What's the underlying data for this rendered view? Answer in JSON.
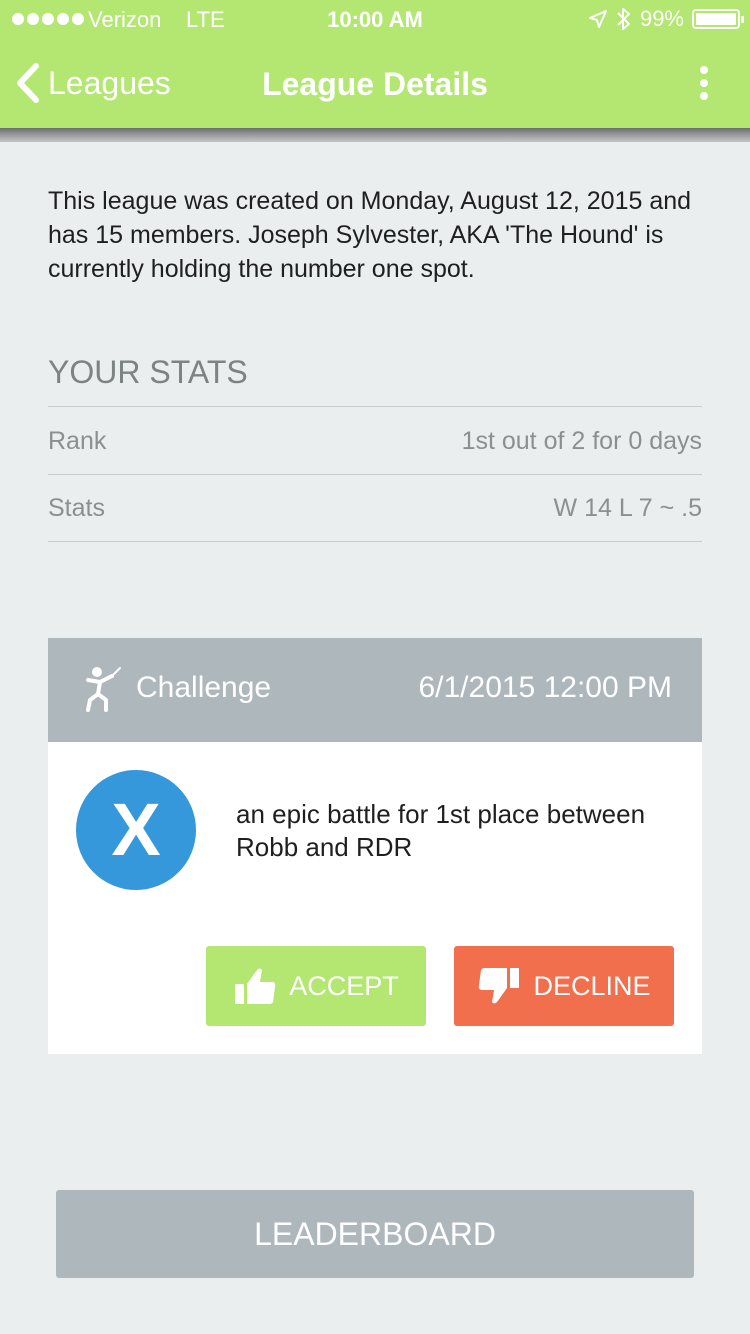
{
  "status_bar": {
    "carrier": "Verizon",
    "network": "LTE",
    "time": "10:00 AM",
    "battery": "99%"
  },
  "nav": {
    "back_label": "Leagues",
    "title": "League Details"
  },
  "intro": "This league was created on Monday, August 12, 2015 and has 15 members. Joseph Sylvester, AKA 'The Hound' is currently holding the number one spot.",
  "your_stats": {
    "title": "YOUR STATS",
    "rows": [
      {
        "label": "Rank",
        "value": "1st out of 2 for 0 days"
      },
      {
        "label": "Stats",
        "value": "W 14 L 7 ~ .5"
      }
    ]
  },
  "challenge": {
    "label": "Challenge",
    "date": "6/1/2015 12:00 PM",
    "avatar_letter": "X",
    "description": "an epic battle for 1st place between Robb and RDR",
    "accept_label": "ACCEPT",
    "decline_label": "DECLINE"
  },
  "leaderboard_label": "LEADERBOARD",
  "colors": {
    "accent_green": "#b3e772",
    "decline_red": "#f26f4e",
    "gray": "#adb7bc",
    "avatar_blue": "#3498db",
    "background": "#ebeeee"
  }
}
